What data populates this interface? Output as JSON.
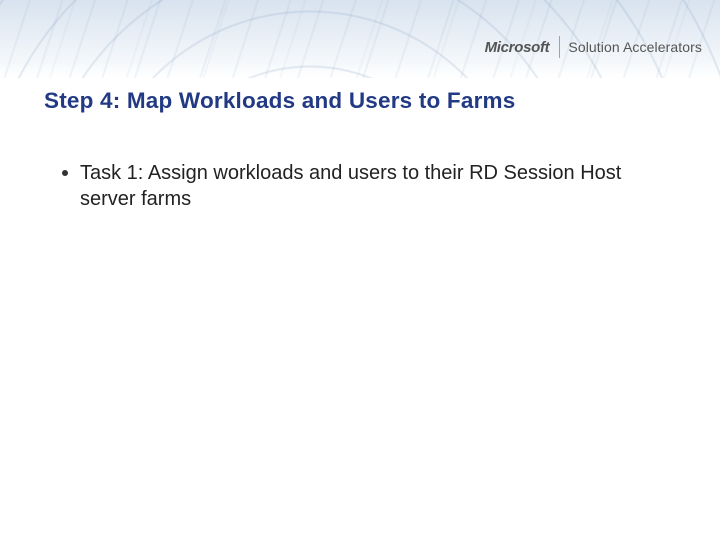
{
  "brand": {
    "company": "Microsoft",
    "product": "Solution Accelerators"
  },
  "slide": {
    "title": "Step 4: Map Workloads and Users to Farms",
    "bullets": [
      "Task 1: Assign workloads and users to their RD Session Host server farms"
    ]
  }
}
